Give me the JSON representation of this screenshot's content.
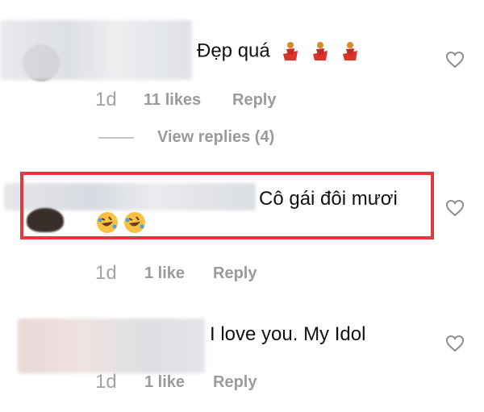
{
  "comments": [
    {
      "text": "Đẹp quá",
      "emojis": [
        "dancer",
        "dancer",
        "dancer"
      ],
      "time": "1d",
      "likes": "11 likes",
      "reply": "Reply",
      "view_replies": "View replies (4)"
    },
    {
      "text": "Cô gái đôi mươi",
      "emojis": [
        "rofl",
        "rofl"
      ],
      "time": "1d",
      "likes": "1 like",
      "reply": "Reply",
      "highlighted": true
    },
    {
      "text": "I love you. My Idol",
      "time": "1d",
      "likes": "1 like",
      "reply": "Reply"
    }
  ],
  "colors": {
    "highlight": "#e0393e",
    "meta": "#9b9b9b"
  },
  "icons": {
    "like": "heart-outline-icon"
  }
}
